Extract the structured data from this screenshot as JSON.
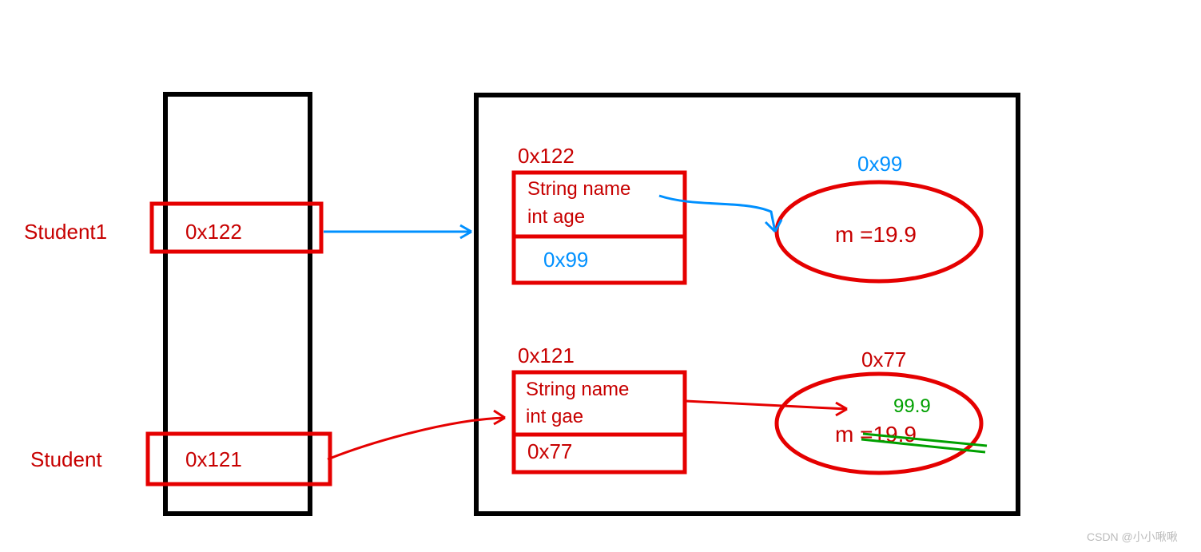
{
  "stack": {
    "entries": [
      {
        "label": "Student1",
        "addr": "0x122"
      },
      {
        "label": "Student",
        "addr": "0x121"
      }
    ]
  },
  "heap": {
    "objects": [
      {
        "addr": "0x122",
        "fields": [
          "String name",
          "int age"
        ],
        "refAddr": "0x99",
        "ref": {
          "addrLabel": "0x99",
          "value": "m =19.9"
        }
      },
      {
        "addr": "0x121",
        "fields": [
          "String name",
          "int gae"
        ],
        "refAddr": "0x77",
        "ref": {
          "addrLabel": "0x77",
          "value": "m =19.9",
          "newValue": "99.9"
        }
      }
    ]
  },
  "watermark": "CSDN @小小啾啾"
}
